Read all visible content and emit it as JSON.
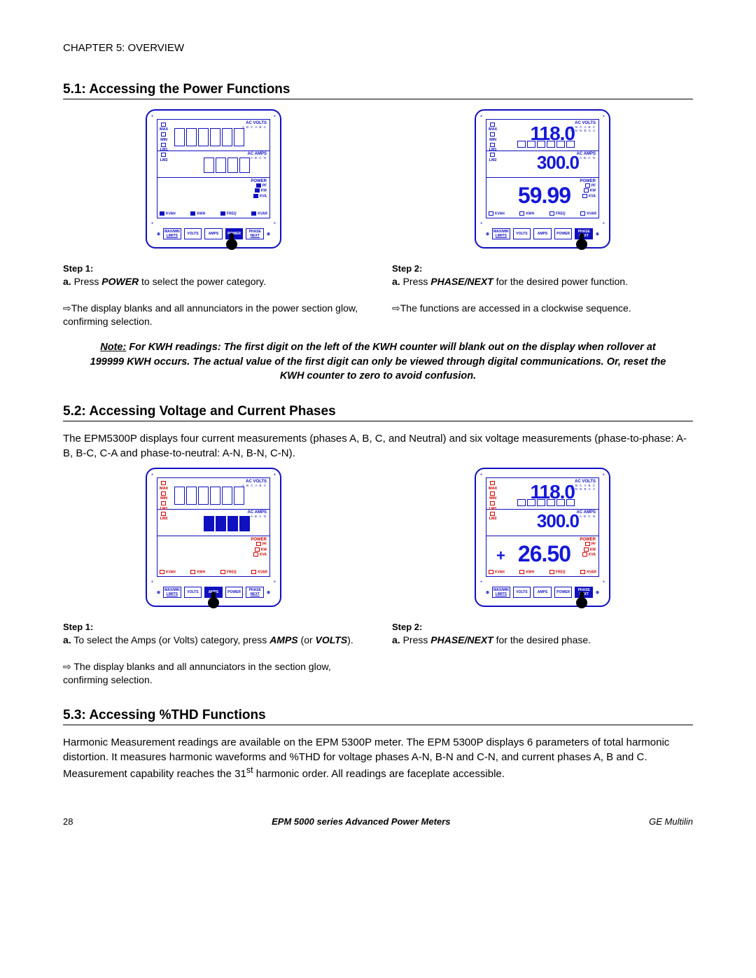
{
  "header": {
    "chapter": "CHAPTER 5: OVERVIEW"
  },
  "section51": {
    "title": "5.1: Accessing the Power Functions",
    "step1_label": "Step 1:",
    "step1_a_prefix": "a.",
    "step1_a_body1": "Press ",
    "step1_a_bold": "POWER",
    "step1_a_body2": " to select the power category.",
    "step1_arrow": "⇨The display blanks and all annunciators in the power section glow, confirming selection.",
    "step2_label": "Step 2:",
    "step2_a_prefix": "a.",
    "step2_a_body1": "Press ",
    "step2_a_bold": "PHASE/NEXT",
    "step2_a_body2": " for the desired power function.",
    "step2_arrow": "⇨The functions are accessed in a clockwise sequence.",
    "note_lead": "Note:",
    "note_body": " For KWH readings: The first digit on the left of the KWH counter will blank out on the display when rollover at 199999 KWH occurs. The actual value of the first digit can only be viewed through digital communications. Or, reset the KWH counter to zero to avoid confusion.",
    "meter2": {
      "r1": "118.0",
      "r2": "300.0",
      "r3": "59.99"
    }
  },
  "section52": {
    "title": "5.2: Accessing Voltage and Current Phases",
    "intro": "The EPM5300P displays four current measurements (phases A, B, C, and Neutral) and six voltage measurements (phase-to-phase: A-B, B-C, C-A and phase-to-neutral: A-N, B-N, C-N).",
    "step1_label": "Step 1:",
    "step1_a_prefix": "a.",
    "step1_a_body1": "To select the Amps (or Volts) category, press ",
    "step1_a_bold": "AMPS",
    "step1_a_mid": " (or ",
    "step1_a_bold2": "VOLTS",
    "step1_a_end": ").",
    "step1_arrow": "⇨ The display blanks and all annunciators in the section glow, confirming selection.",
    "step2_label": "Step 2:",
    "step2_a_prefix": "a.",
    "step2_a_body1": "Press ",
    "step2_a_bold": "PHASE/NEXT",
    "step2_a_body2": " for the desired phase.",
    "meter2": {
      "r1": "118.0",
      "r2": "300.0",
      "r3": "26.50",
      "plus": "+"
    }
  },
  "section53": {
    "title": "5.3: Accessing %THD Functions",
    "body_a": "Harmonic Measurement readings are available on the EPM 5300P meter. The EPM 5300P displays 6 parameters of total harmonic distortion. It measures harmonic waveforms and %THD for voltage phases A-N, B-N and C-N, and current phases A, B and C.  Measurement capability reaches the 31",
    "body_sup": "st",
    "body_b": " harmonic order. All readings are faceplate accessible."
  },
  "meter_labels": {
    "acvolts": "AC VOLTS",
    "acvolts_sub": "A  B  C  A  B  C",
    "acvolts_sub2": "N  N  N  B  C  A",
    "acamps": "AC AMPS",
    "acamps_sub": "A  B  C  N",
    "power": "POWER",
    "pf": "PF",
    "kw": "KW",
    "kva": "KVA",
    "kvah": "KVAH",
    "kwh": "KWH",
    "freq": "FREQ",
    "kvar": "KVAR",
    "max": "MAX",
    "min": "MIN",
    "lm1": "LM1",
    "lm2": "LM2",
    "btn_maxmin_t": "MAX/MIN",
    "btn_maxmin_b": "LIMITS",
    "btn_volts": "VOLTS",
    "btn_amps": "AMPS",
    "btn_power": "POWER",
    "btn_phase_t": "PHASE",
    "btn_phase_b": "NEXT"
  },
  "footer": {
    "page": "28",
    "mid": "EPM 5000 series Advanced Power Meters",
    "right": "GE Multilin"
  }
}
